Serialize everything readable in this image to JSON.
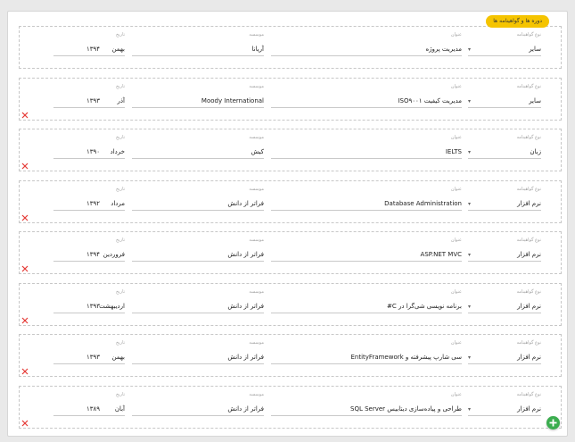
{
  "section": {
    "title": "دوره ها و گواهینامه ها"
  },
  "labels": {
    "type": "نوع گواهینامه",
    "title": "عنوان",
    "org": "موسسه",
    "date": "تاریخ"
  },
  "entries": [
    {
      "type": "سایر",
      "title": "مدیریت پروژه",
      "org": "آریانا",
      "month": "بهمن",
      "year": "۱۳۹۴",
      "removable": false
    },
    {
      "type": "سایر",
      "title": "مدیریت کیفیت ISO۹۰۰۱",
      "org": "Moody International",
      "month": "آذر",
      "year": "۱۳۹۳",
      "removable": true
    },
    {
      "type": "زبان",
      "title": "IELTS",
      "org": "کیش",
      "month": "خرداد",
      "year": "۱۳۹۰",
      "removable": true
    },
    {
      "type": "نرم افزار",
      "title": "Database Administration",
      "org": "فراتر از دانش",
      "month": "مرداد",
      "year": "۱۳۹۲",
      "removable": true
    },
    {
      "type": "نرم افزار",
      "title": "ASP.NET MVC",
      "org": "فراتر از دانش",
      "month": "فروردین",
      "year": "۱۳۹۴",
      "removable": true
    },
    {
      "type": "نرم افزار",
      "title": "برنامه نویسی شی‌گرا در C#",
      "org": "فراتر از دانش",
      "month": "اردیبهشت",
      "year": "۱۳۹۳",
      "removable": true
    },
    {
      "type": "نرم افزار",
      "title": "سی شارپ پیشرفته و EntityFramework",
      "org": "فراتر از دانش",
      "month": "بهمن",
      "year": "۱۳۹۳",
      "removable": true
    },
    {
      "type": "نرم افزار",
      "title": "طراحی و پیاده‌سازی دیتابیس SQL Server",
      "org": "فراتر از دانش",
      "month": "آبان",
      "year": "۱۳۸۹",
      "removable": true
    }
  ],
  "icons": {
    "remove": "close-icon",
    "add": "plus-icon",
    "dropdown": "caret-down-icon"
  },
  "colors": {
    "badge": "#f5c400",
    "remove": "#e53935",
    "add": "#3bad4f"
  }
}
